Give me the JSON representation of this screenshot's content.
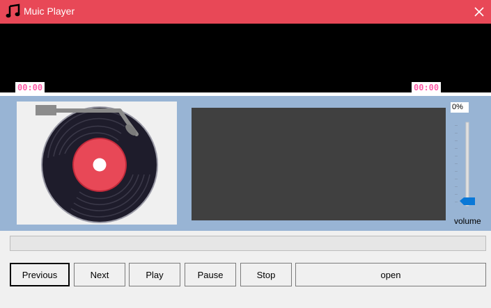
{
  "window": {
    "title": "Muic Player",
    "icon": "music-note-icon",
    "accent_color": "#e84857"
  },
  "video": {
    "time_elapsed": "00:00",
    "time_total": "00:00",
    "time_color": "#ff5ca8"
  },
  "volume": {
    "percent_label": "0%",
    "label": "volume",
    "value": 0
  },
  "progress": {
    "value": 0
  },
  "buttons": {
    "previous": "Previous",
    "next": "Next",
    "play": "Play",
    "pause": "Pause",
    "stop": "Stop",
    "open": "open"
  }
}
